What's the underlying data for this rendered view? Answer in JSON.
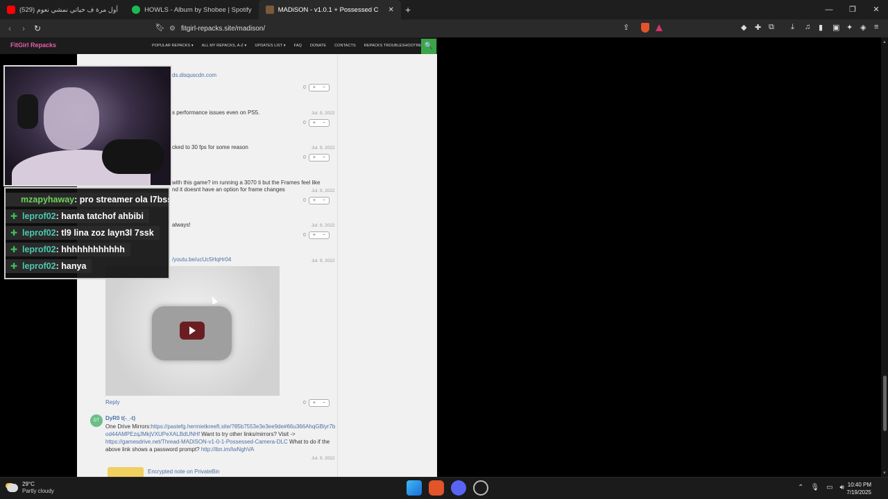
{
  "browser": {
    "tabs": [
      {
        "label": "(529) أول مرة ف حياتي نمشي نعوم",
        "icon": "youtube-icon",
        "color": "#ff0000"
      },
      {
        "label": "HOWLS - Album by Shobee | Spotify",
        "icon": "spotify-icon",
        "color": "#1db954"
      },
      {
        "label": "MADiSON - v1.0.1 + Possessed C",
        "icon": "game-icon",
        "color": "#7a5a3a"
      }
    ],
    "new_tab": "+",
    "window_controls": [
      "—",
      "❐",
      "✕"
    ],
    "url": "fitgirl-repacks.site/madison/"
  },
  "site": {
    "logo": "FitGirl Repacks",
    "menu": [
      "POPULAR REPACKS ▾",
      "ALL MY REPACKS, A-Z ▾",
      "UPDATES LIST ▾",
      "FAQ",
      "DONATE",
      "CONTACTS",
      "REPACKS TROUBLESHOOTING"
    ],
    "search_icon": "🔍"
  },
  "comments": {
    "link1": "ds.disquscdn.com",
    "c1_vote": "0",
    "c2_text": "s performance issues even on PS5.",
    "c2_date": "Jul. 9, 2022",
    "c2_vote": "0",
    "c3_text": "cked to 30 fps for some reason",
    "c3_date": "Jul. 9, 2022",
    "c3_vote": "0",
    "c4_text1": " with this game? im running a 3070 ti but the Frames feel like",
    "c4_text2": "nd it doesnt have an option for frame changes",
    "c4_date": "Jul. 9, 2022",
    "c4_vote": "0",
    "c5_text": "always!",
    "c5_date": "Jul. 9, 2022",
    "c5_vote": "0",
    "c6_link": "/youtu.be/ucUc5HqHr04",
    "c6_date": "Jul. 9, 2022",
    "reply": "Reply",
    "c6_vote": "0",
    "c7_avatar": "DT",
    "c7_user": "DyR0 t(-_-t)",
    "c7_p1": "One Drive Mirrors:",
    "c7_link1": "https://pastefg.hermietkreeft.site/?85b7553e3e3ee9de#66u366AhqGBiyr7bod44AMPEzqJMkjVXUPeXALBdUNHf",
    "c7_p2": " Want to try other links/mirrors? Visit -> ",
    "c7_link2": "https://gamesdrive.net/Thread-MADiSON-v1-0-1-Possessed-Camera-DLC",
    "c7_p3": " What to do if the above link shows a password prompt? ",
    "c7_link3": "http://ibn.im/IwNghVA",
    "c7_date": "Jul. 9, 2022",
    "note_link": "Encrypted note on PrivateBin"
  },
  "chat": [
    {
      "user": "mzapyhaway",
      "msg": ": pro streamer ola l7bss",
      "badge": false
    },
    {
      "user": "leprof02",
      "msg": ": hanta tatchof ahbibi",
      "badge": true
    },
    {
      "user": "leprof02",
      "msg": ": tl9 lina zoz layn3l 7ssk",
      "badge": true
    },
    {
      "user": "leprof02",
      "msg": ": hhhhhhhhhhhh",
      "badge": true
    },
    {
      "user": "leprof02",
      "msg": ": hanya",
      "badge": true
    }
  ],
  "taskbar": {
    "temp": "29°C",
    "weather": "Partly cloudy",
    "time": "10:40 PM",
    "date": "7/19/2025"
  }
}
